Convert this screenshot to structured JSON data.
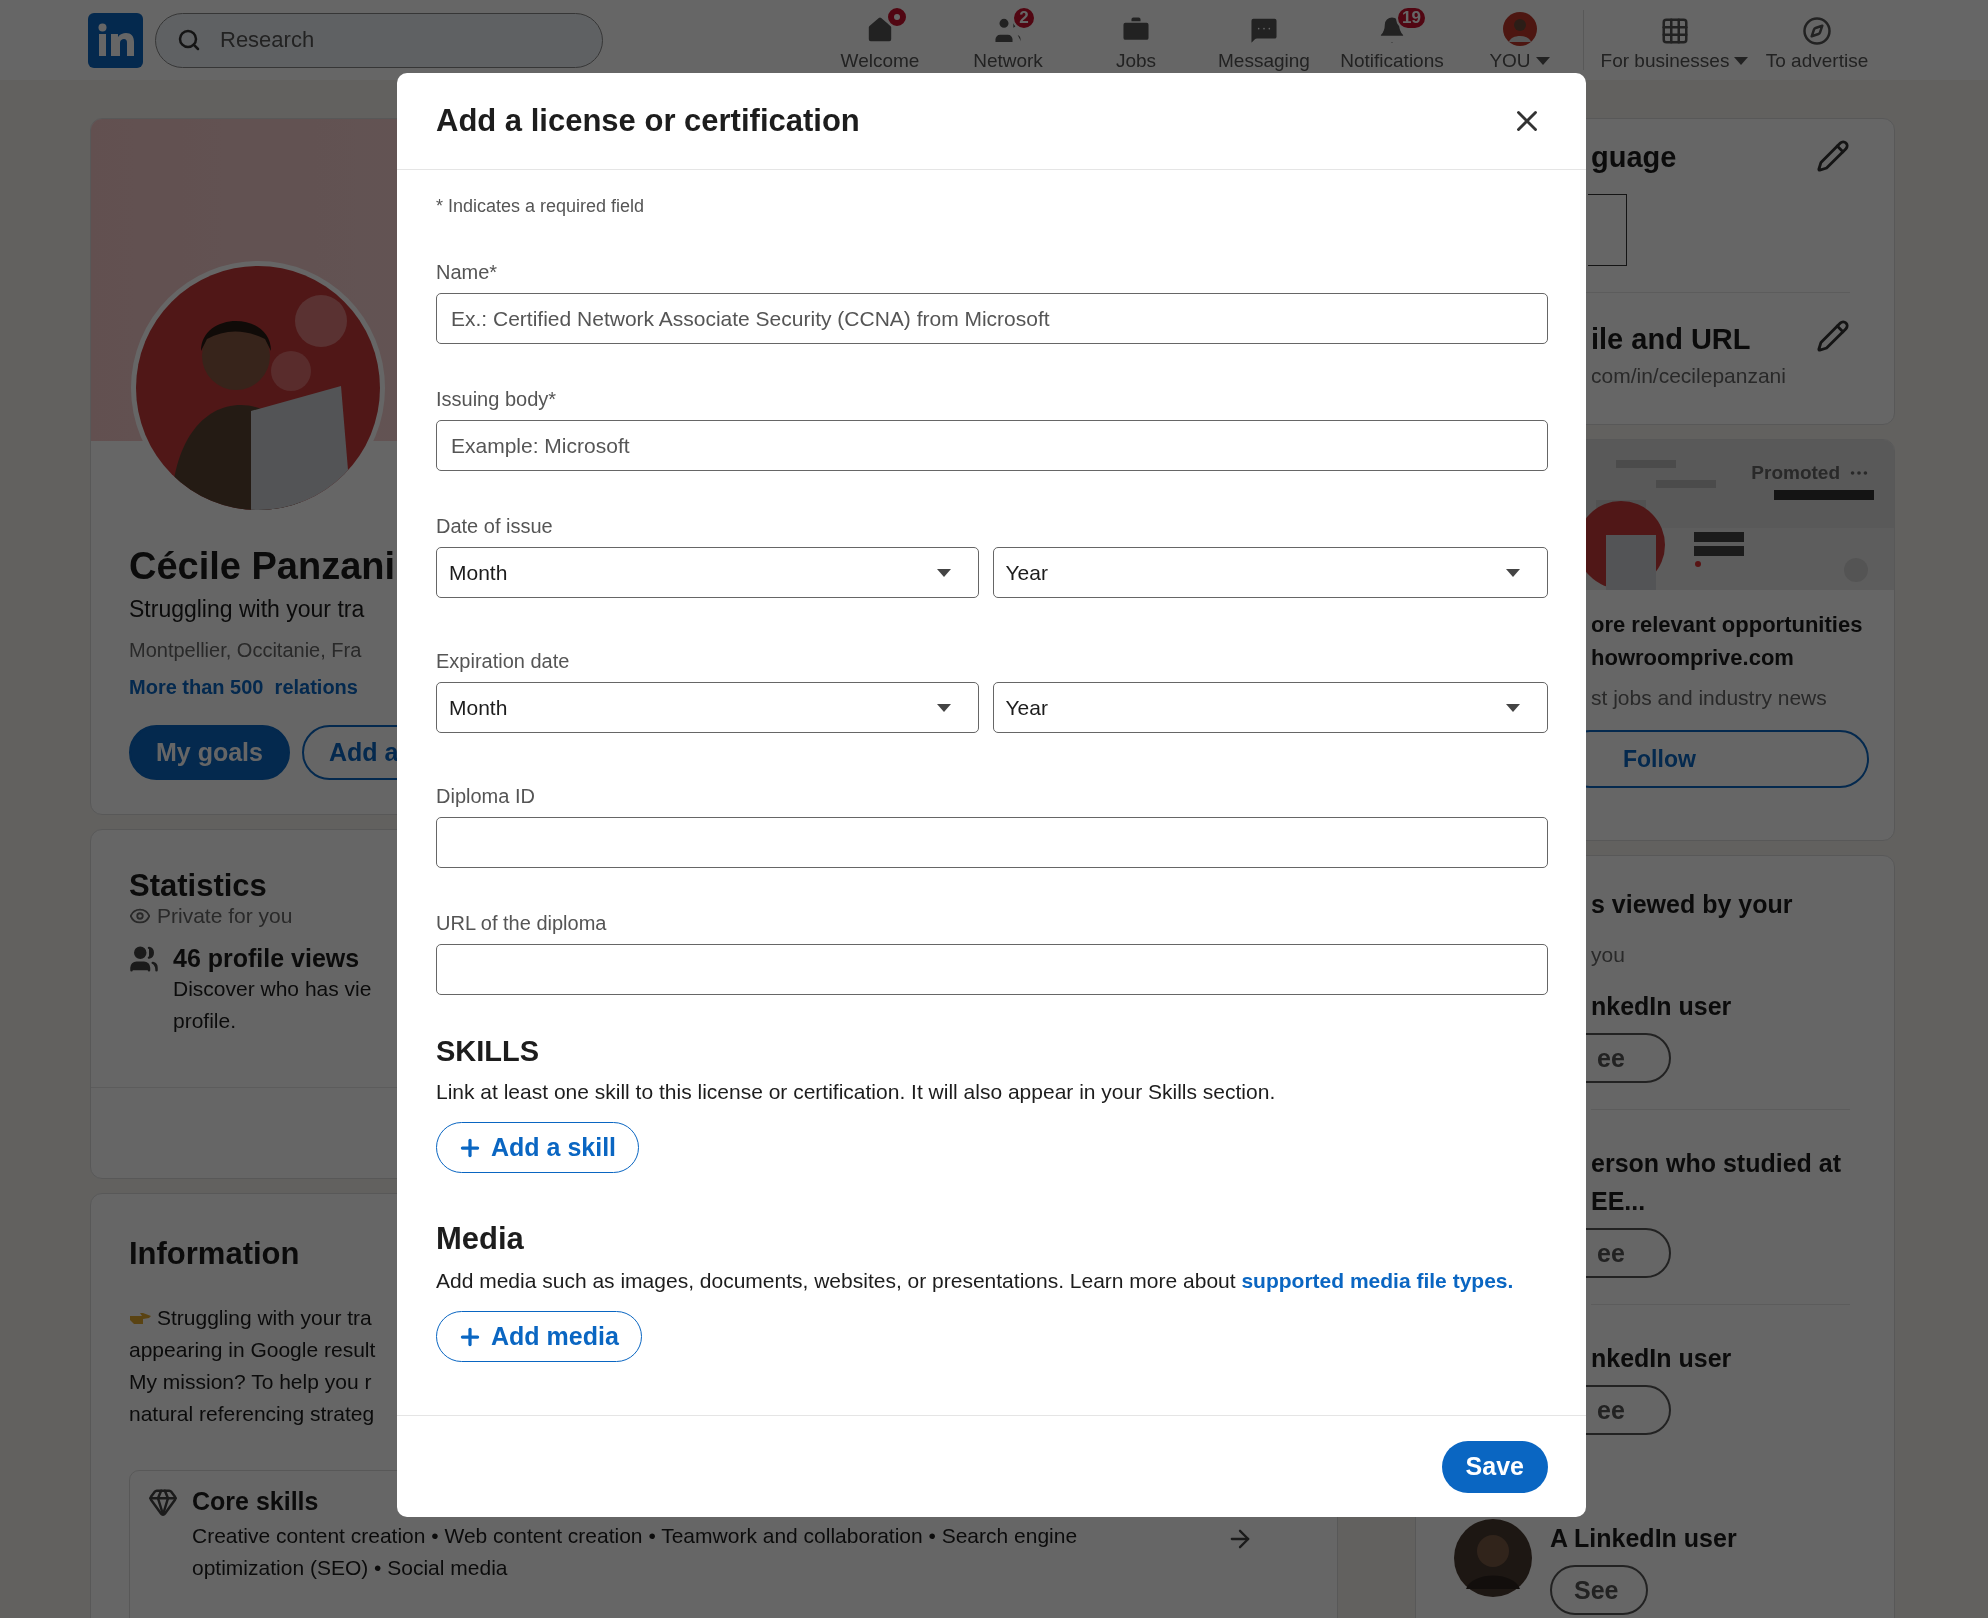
{
  "header": {
    "search": {
      "placeholder": "Research"
    },
    "nav": [
      {
        "label": "Welcome",
        "dot": true,
        "dropdown": false
      },
      {
        "label": "Network",
        "badge": "2",
        "dot": false,
        "dropdown": false
      },
      {
        "label": "Jobs",
        "dot": false,
        "dropdown": false
      },
      {
        "label": "Messaging",
        "dot": false,
        "dropdown": false
      },
      {
        "label": "Notifications",
        "badge": "19",
        "dot": false,
        "dropdown": false
      },
      {
        "label": "YOU",
        "dot": false,
        "dropdown": true
      }
    ],
    "business": [
      {
        "label": "For businesses",
        "dropdown": true
      },
      {
        "label": "To advertise",
        "dropdown": false
      }
    ]
  },
  "profile": {
    "name": "Cécile Panzani",
    "headline": "Struggling with your tra",
    "location": "Montpellier, Occitanie, Fra",
    "relations": "More than 500  relations",
    "buttons": [
      {
        "label": "My goals",
        "kind": "primary"
      },
      {
        "label": "Add a",
        "kind": "outline"
      }
    ]
  },
  "statistics": {
    "title": "Statistics",
    "privacy": "Private for you",
    "views": "46 profile views",
    "text_lines": [
      "Discover who has vie",
      "profile."
    ]
  },
  "information": {
    "title": "Information",
    "lines": [
      "Struggling with your tra",
      "appearing in Google result",
      "My mission? To help you r",
      "natural referencing strateg"
    ],
    "core_skills": {
      "title": "Core skills",
      "text": "Creative content creation • Web content creation • Teamwork and collaboration • Search engine optimization (SEO) • Social media"
    }
  },
  "sidebar": {
    "language": {
      "title": "guage"
    },
    "profile_url": {
      "title": "ile and URL",
      "url": "com/in/cecilepanzani"
    },
    "promo": {
      "label": "Promoted",
      "title_lines": [
        "ore relevant opportunities",
        "howroomprive.com"
      ],
      "text": "st jobs and industry news",
      "button": "Follow"
    },
    "viewers": {
      "title": "s viewed by your",
      "subtitle": "you",
      "people": [
        {
          "name_lines": [
            "nkedIn user"
          ],
          "button": "ee"
        },
        {
          "name_lines": [
            "erson who studied at",
            "EE..."
          ],
          "button": "ee"
        },
        {
          "name_lines": [
            "nkedIn user"
          ],
          "button": "ee"
        }
      ],
      "last": {
        "name": "A LinkedIn user",
        "button": "See"
      }
    }
  },
  "modal": {
    "title": "Add a license or certification",
    "required_note": "* Indicates a required field",
    "fields": [
      {
        "kind": "text",
        "label": "Name*",
        "placeholder": "Ex.: Certified Network Associate Security (CCNA) from Microsoft"
      },
      {
        "kind": "text",
        "label": "Issuing body*",
        "placeholder": "Example: Microsoft"
      },
      {
        "kind": "date",
        "label": "Date of issue",
        "selects": [
          {
            "value": "Month"
          },
          {
            "value": "Year"
          }
        ]
      },
      {
        "kind": "date",
        "label": "Expiration date",
        "selects": [
          {
            "value": "Month"
          },
          {
            "value": "Year"
          }
        ]
      },
      {
        "kind": "text",
        "label": "Diploma ID"
      },
      {
        "kind": "text",
        "label": "URL of the diploma"
      }
    ],
    "skills": {
      "title": "SKILLS",
      "text": "Link at least one skill to this license or certification. It will also appear in your Skills section.",
      "button": "Add a skill"
    },
    "media": {
      "title": "Media",
      "text": "Add media such as images, documents, websites, or presentations. Learn more about ",
      "link": "supported media file types.",
      "button": "Add media"
    },
    "save": "Save"
  }
}
